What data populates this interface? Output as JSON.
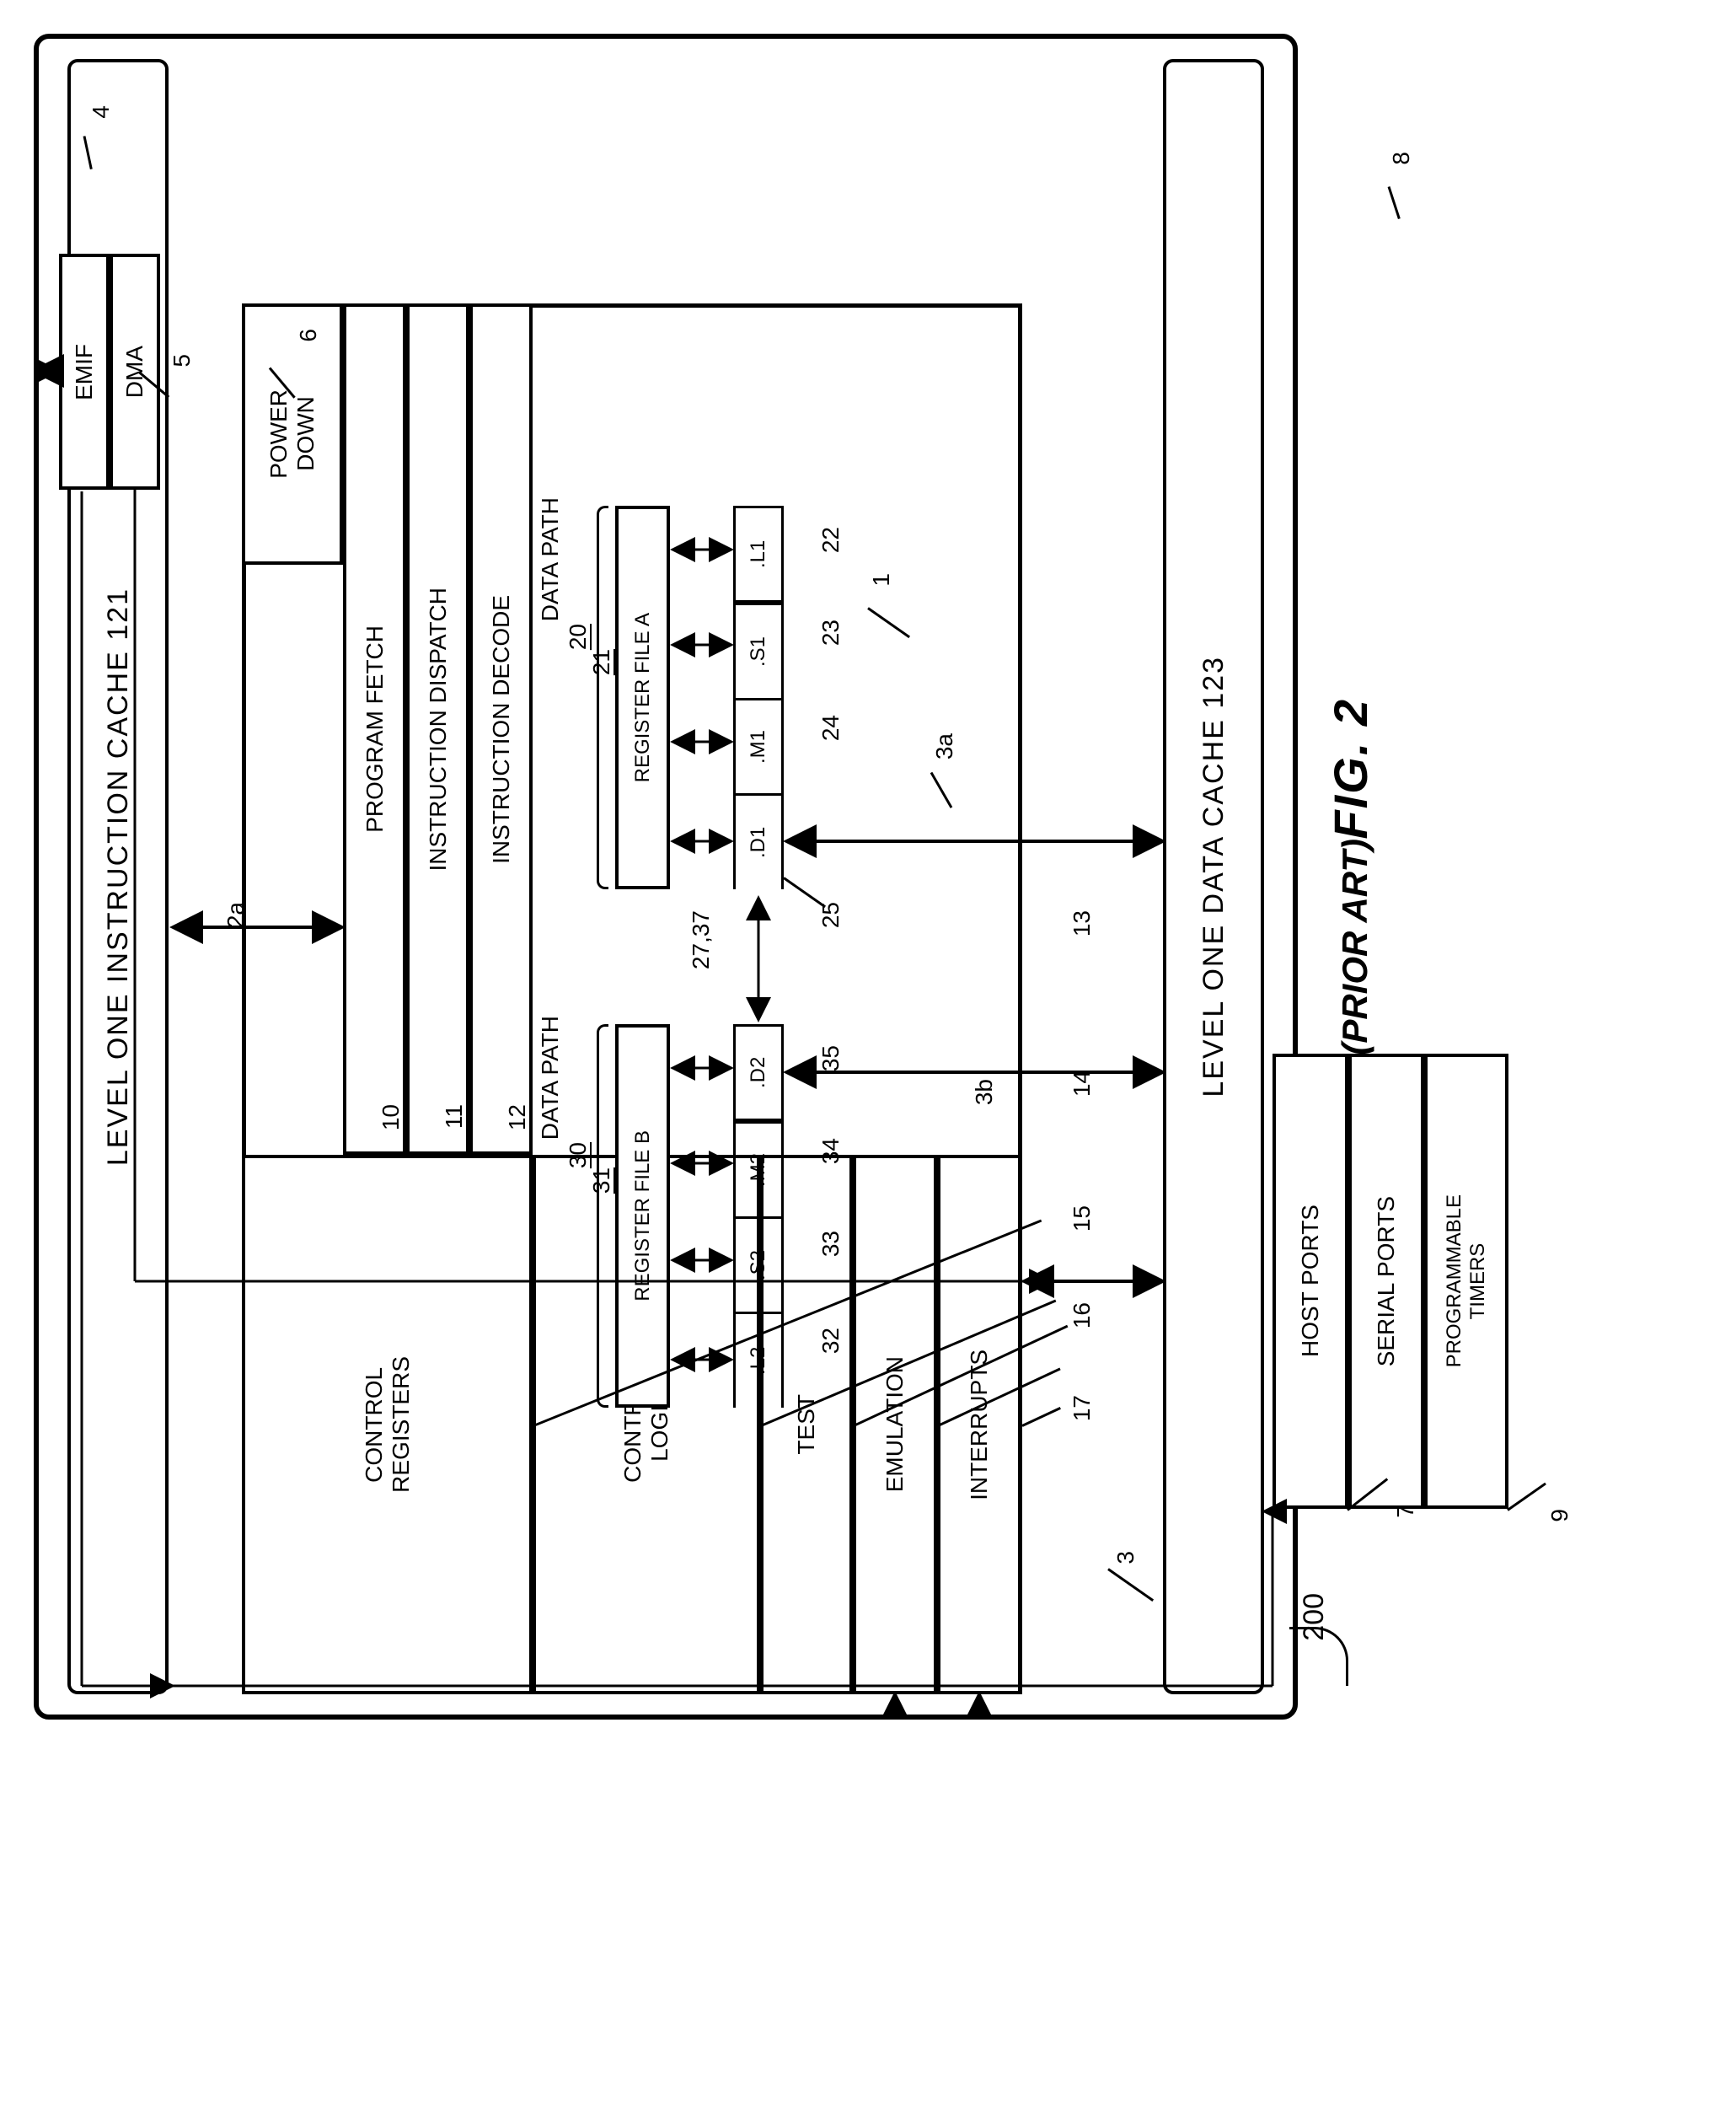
{
  "title": "FIG. 2",
  "subtitle": "(PRIOR ART)",
  "chip_label": "200",
  "blocks": {
    "l1i": "LEVEL ONE INSTRUCTION CACHE 121",
    "l1d": "LEVEL ONE DATA CACHE 123",
    "power_down": "POWER\nDOWN",
    "emif": "EMIF",
    "dma": "DMA",
    "program_fetch": "PROGRAM FETCH",
    "instr_dispatch": "INSTRUCTION DISPATCH",
    "instr_decode": "INSTRUCTION DECODE",
    "ctrl_reg": "CONTROL\nREGISTERS",
    "ctrl_logic": "CONTROL\nLOGIC",
    "test": "TEST",
    "emulation": "EMULATION",
    "interrupts": "INTERRUPTS",
    "host_ports": "HOST PORTS",
    "serial_ports": "SERIAL PORTS",
    "prog_timers": "PROGRAMMABLE\nTIMERS",
    "dp_a_title": "DATA PATH",
    "dp_a_num": "20",
    "dp_b_title": "DATA PATH",
    "dp_b_num": "30",
    "reg_a": "REGISTER FILE A",
    "reg_b": "REGISTER FILE B",
    "units_a": [
      ".L1",
      ".S1",
      ".M1",
      ".D1"
    ],
    "units_b": [
      ".D2",
      ".M2",
      ".S2",
      ".L2"
    ]
  },
  "numbers": {
    "pf": "10",
    "id": "11",
    "idec": "12",
    "ctrlreg": "13",
    "ctrllog": "14",
    "test": "15",
    "emul": "16",
    "intr": "17",
    "hostp": "7",
    "serp": "8",
    "progt": "9",
    "power": "6",
    "emif": "4",
    "dma": "5",
    "rega": "21",
    "regb": "31",
    "l1": "22",
    "s1": "23",
    "m1": "24",
    "d1": "25",
    "l2": "32",
    "s2": "33",
    "m2": "34",
    "d2": "35",
    "xchg": "27,37",
    "core": "1",
    "lnka": "3a",
    "lnkb": "3b",
    "lnk2a": "2a",
    "l1dnum": "3"
  }
}
